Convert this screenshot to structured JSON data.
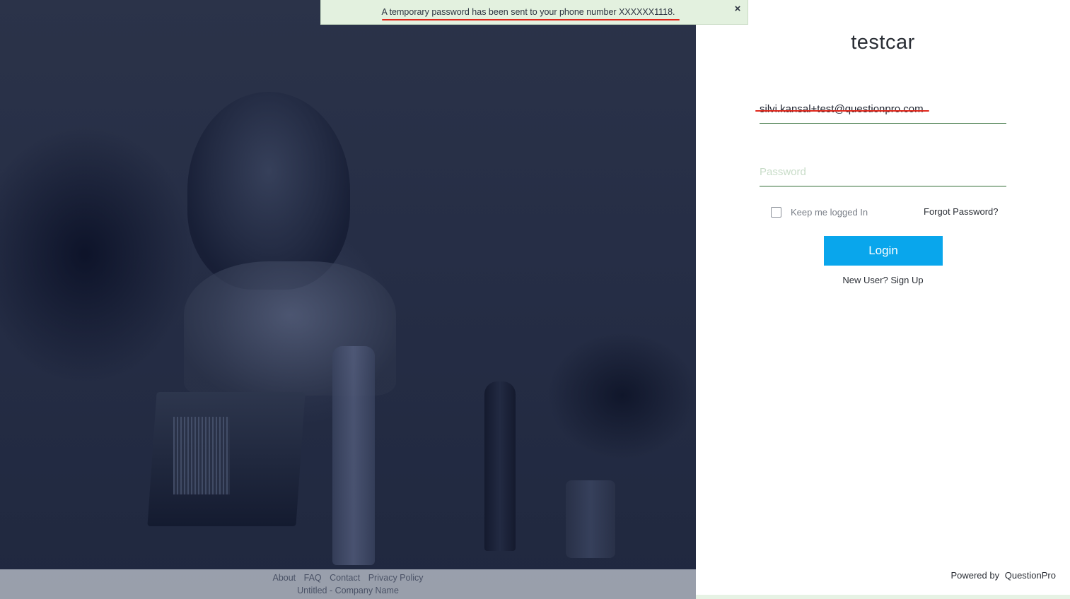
{
  "notification": {
    "message": "A temporary password has been sent to your phone number XXXXXX1118.",
    "close_icon": "close-icon",
    "close_glyph": "×"
  },
  "brand": {
    "title": "testcar"
  },
  "login_form": {
    "email_value": "silvi.kansal+test@questionpro.com",
    "password_placeholder": "Password",
    "keep_logged_in_label": "Keep me logged In",
    "keep_logged_in_checked": false,
    "forgot_password_label": "Forgot Password?",
    "login_button_label": "Login",
    "new_user_text": "New User?",
    "sign_up_label": "Sign Up"
  },
  "footer": {
    "links": [
      "About",
      "FAQ",
      "Contact",
      "Privacy Policy"
    ],
    "copyright": "Untitled - Company Name"
  },
  "powered_by": {
    "label": "Powered by",
    "brand": "QuestionPro"
  },
  "colors": {
    "primary_button": "#09a6ec",
    "field_underline": "#2f6b34",
    "notification_bg": "#e3f1df",
    "annotation_red": "#e0271b"
  }
}
